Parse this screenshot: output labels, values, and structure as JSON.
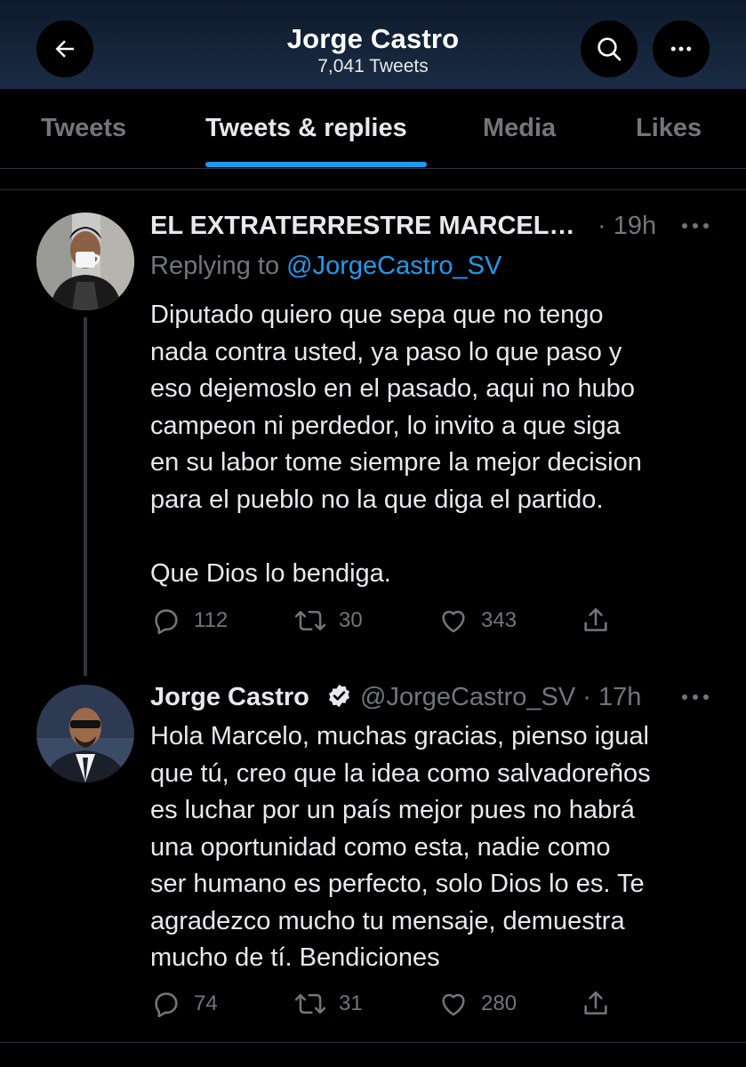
{
  "header": {
    "title": "Jorge Castro",
    "subtitle": "7,041 Tweets",
    "back_icon": "arrow-left-icon",
    "search_icon": "search-icon",
    "more_icon": "more-dots-icon"
  },
  "tabs": [
    {
      "label": "Tweets",
      "active": false
    },
    {
      "label": "Tweets & replies",
      "active": true
    },
    {
      "label": "Media",
      "active": false
    },
    {
      "label": "Likes",
      "active": false
    }
  ],
  "colors": {
    "accent": "#1d9bf0",
    "text": "#e7e9ea",
    "muted": "#71767b",
    "background": "#000000",
    "header": "#14233a"
  },
  "tweets": [
    {
      "author": "EL EXTRATERRESTRE MARCEL…",
      "meta": "· 19h",
      "reply_prefix": "Replying to",
      "reply_handle": "@JorgeCastro_SV",
      "text": "Diputado quiero que sepa que no tengo\nnada contra usted, ya paso lo que paso y\neso dejemoslo en el pasado, aqui no hubo\ncampeon ni perdedor, lo invito a que siga\nen su labor tome siempre la mejor decision\npara el pueblo no la que diga el partido.\n\nQue Dios lo bendiga.",
      "replies": "112",
      "retweets": "30",
      "likes": "343"
    },
    {
      "author": "Jorge Castro",
      "verified": true,
      "meta": "@JorgeCastro_SV · 17h",
      "text": "Hola Marcelo, muchas gracias, pienso igual\nque tú, creo que la idea como salvadoreños\nes luchar por un país mejor pues no habrá\nuna oportunidad como esta, nadie como\nser humano es perfecto, solo Dios lo es. Te\nagradezco mucho tu mensaje, demuestra\nmucho de tí. Bendiciones",
      "replies": "74",
      "retweets": "31",
      "likes": "280"
    }
  ]
}
